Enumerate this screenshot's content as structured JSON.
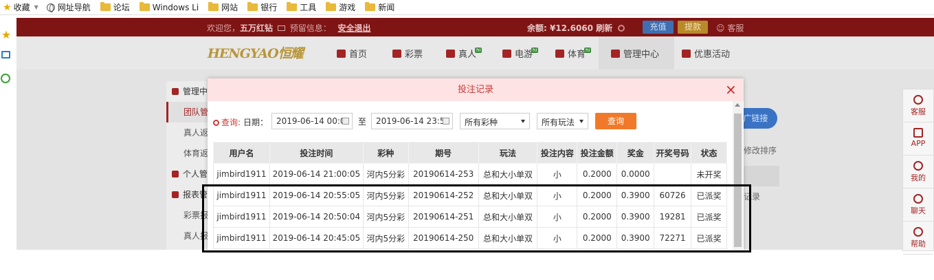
{
  "bookmarks": {
    "favorites": "收藏",
    "items": [
      "网址导航",
      "论坛",
      "Windows Li",
      "网站",
      "银行",
      "工具",
      "游戏",
      "新闻"
    ]
  },
  "topbar": {
    "welcome": "欢迎您，",
    "username": "五万红钻",
    "notice_label": "预留信息：",
    "logout": "安全退出",
    "balance_label": "余额: ",
    "balance": "¥12.6060",
    "refresh": "刷新",
    "deposit": "充值",
    "withdraw": "提款",
    "service": "客服"
  },
  "nav": {
    "logo": "HENGYAO恒耀",
    "items": [
      {
        "label": "首页",
        "badge": ""
      },
      {
        "label": "彩票",
        "badge": ""
      },
      {
        "label": "真人",
        "badge": "hi"
      },
      {
        "label": "电游",
        "badge": "hi"
      },
      {
        "label": "体育",
        "badge": "hi"
      },
      {
        "label": "管理中心",
        "badge": ""
      },
      {
        "label": "优惠活动",
        "badge": ""
      }
    ]
  },
  "sidebar": {
    "items": [
      "管理中",
      "团队管",
      "真人返",
      "体育返",
      "个人管",
      "报表管",
      "彩票报",
      "真人报"
    ]
  },
  "background_right": {
    "button": "广链接",
    "text1": "修改排序",
    "text2": "记录"
  },
  "right_rail": {
    "items": [
      "客服",
      "APP",
      "我的",
      "聊天",
      "帮助"
    ]
  },
  "modal": {
    "title": "投注记录",
    "close": "×",
    "query_label": "查询:",
    "date_label": "日期：",
    "date_from": "2019-06-14 00:0",
    "to": "至",
    "date_to": "2019-06-14 23:5",
    "lottery_select": "所有彩种",
    "play_select": "所有玩法",
    "query_button": "查询"
  },
  "table": {
    "headers": [
      "用户名",
      "投注时间",
      "彩种",
      "期号",
      "玩法",
      "投注内容",
      "投注金额",
      "奖金",
      "开奖号码",
      "状态"
    ],
    "rows": [
      [
        "jimbird1911",
        "2019-06-14 21:00:05",
        "河内5分彩",
        "20190614-253",
        "总和大小单双",
        "小",
        "0.2000",
        "0.0000",
        "",
        "未开奖"
      ],
      [
        "jimbird1911",
        "2019-06-14 20:55:05",
        "河内5分彩",
        "20190614-252",
        "总和大小单双",
        "小",
        "0.2000",
        "0.3900",
        "60726",
        "已派奖"
      ],
      [
        "jimbird1911",
        "2019-06-14 20:50:04",
        "河内5分彩",
        "20190614-251",
        "总和大小单双",
        "小",
        "0.2000",
        "0.3900",
        "19281",
        "已派奖"
      ],
      [
        "jimbird1911",
        "2019-06-14 20:45:05",
        "河内5分彩",
        "20190614-250",
        "总和大小单双",
        "小",
        "0.2000",
        "0.3900",
        "72271",
        "已派奖"
      ]
    ]
  },
  "colors": {
    "topbar": "#7f1414",
    "modal_header": "#fde3e3",
    "query_button": "#f07a2a",
    "status_pending": "#2e9a2e",
    "status_paid": "#d23a3a"
  }
}
